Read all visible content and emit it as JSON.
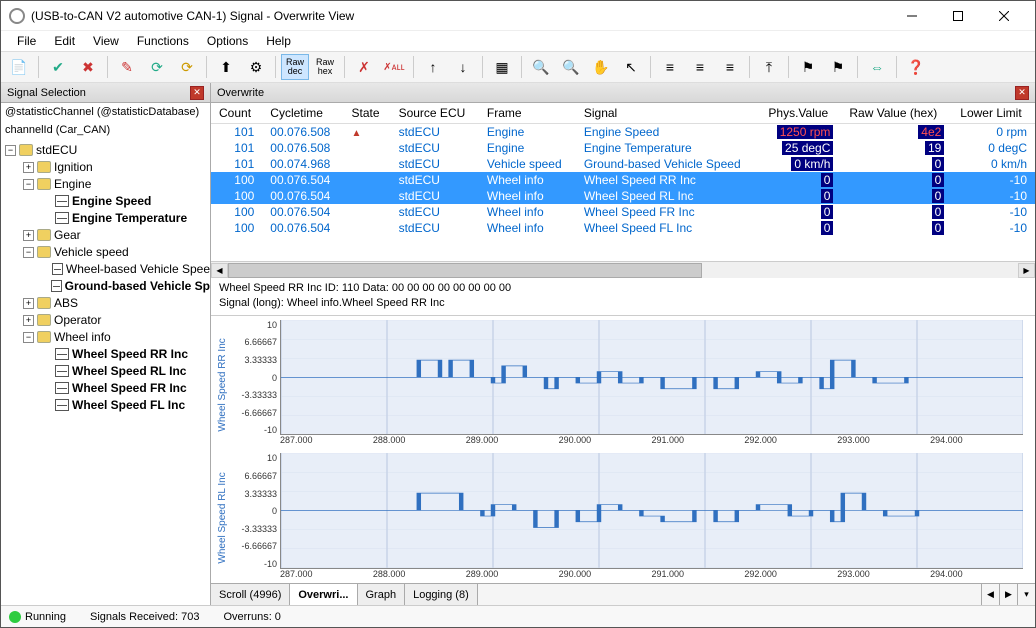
{
  "window": {
    "title": "(USB-to-CAN V2 automotive  CAN-1) Signal - Overwrite View"
  },
  "menu": [
    "File",
    "Edit",
    "View",
    "Functions",
    "Options",
    "Help"
  ],
  "sidebar": {
    "title": "Signal Selection",
    "info1": "@statisticChannel  (@statisticDatabase)",
    "info2": "channelId  (Car_CAN)",
    "tree": [
      {
        "lvl": 0,
        "exp": "-",
        "icon": "db",
        "label": "stdECU",
        "bold": false
      },
      {
        "lvl": 1,
        "exp": "+",
        "icon": "db",
        "label": "Ignition",
        "bold": false
      },
      {
        "lvl": 1,
        "exp": "-",
        "icon": "db",
        "label": "Engine",
        "bold": false
      },
      {
        "lvl": 2,
        "exp": "",
        "icon": "sig",
        "label": "Engine Speed",
        "bold": true
      },
      {
        "lvl": 2,
        "exp": "",
        "icon": "sig",
        "label": "Engine Temperature",
        "bold": true
      },
      {
        "lvl": 1,
        "exp": "+",
        "icon": "db",
        "label": "Gear",
        "bold": false
      },
      {
        "lvl": 1,
        "exp": "-",
        "icon": "db",
        "label": "Vehicle speed",
        "bold": false
      },
      {
        "lvl": 2,
        "exp": "",
        "icon": "sig",
        "label": "Wheel-based Vehicle Spee",
        "bold": false
      },
      {
        "lvl": 2,
        "exp": "",
        "icon": "sig",
        "label": "Ground-based Vehicle Sp",
        "bold": true
      },
      {
        "lvl": 1,
        "exp": "+",
        "icon": "db",
        "label": "ABS",
        "bold": false
      },
      {
        "lvl": 1,
        "exp": "+",
        "icon": "db",
        "label": "Operator",
        "bold": false
      },
      {
        "lvl": 1,
        "exp": "-",
        "icon": "db",
        "label": "Wheel info",
        "bold": false
      },
      {
        "lvl": 2,
        "exp": "",
        "icon": "sig",
        "label": "Wheel Speed RR Inc",
        "bold": true
      },
      {
        "lvl": 2,
        "exp": "",
        "icon": "sig",
        "label": "Wheel Speed RL Inc",
        "bold": true
      },
      {
        "lvl": 2,
        "exp": "",
        "icon": "sig",
        "label": "Wheel Speed FR Inc",
        "bold": true
      },
      {
        "lvl": 2,
        "exp": "",
        "icon": "sig",
        "label": "Wheel Speed FL Inc",
        "bold": true
      }
    ]
  },
  "overwrite": {
    "title": "Overwrite",
    "columns": [
      "Count",
      "Cycletime",
      "State",
      "Source ECU",
      "Frame",
      "Signal",
      "Phys.Value",
      "Raw Value (hex)",
      "Lower Limit"
    ],
    "rows": [
      {
        "count": "101",
        "cycle": "00.076.508",
        "state": "▲",
        "ecu": "stdECU",
        "frame": "Engine",
        "signal": "Engine Speed",
        "pv": "1250 rpm",
        "pvcls": "red",
        "rv": "4e2",
        "rvcls": "red",
        "ll": "0 rpm",
        "sel": false
      },
      {
        "count": "101",
        "cycle": "00.076.508",
        "state": "",
        "ecu": "stdECU",
        "frame": "Engine",
        "signal": "Engine Temperature",
        "pv": "25 degC",
        "pvcls": "dark",
        "rv": "19",
        "rvcls": "dark",
        "ll": "0 degC",
        "sel": false
      },
      {
        "count": "101",
        "cycle": "00.074.968",
        "state": "",
        "ecu": "stdECU",
        "frame": "Vehicle speed",
        "signal": "Ground-based Vehicle Speed",
        "pv": "0 km/h",
        "pvcls": "dark",
        "rv": "0",
        "rvcls": "dark",
        "ll": "0 km/h",
        "sel": false
      },
      {
        "count": "100",
        "cycle": "00.076.504",
        "state": "",
        "ecu": "stdECU",
        "frame": "Wheel info",
        "signal": "Wheel Speed RR Inc",
        "pv": "0",
        "pvcls": "dark",
        "rv": "0",
        "rvcls": "dark",
        "ll": "-10",
        "sel": true
      },
      {
        "count": "100",
        "cycle": "00.076.504",
        "state": "",
        "ecu": "stdECU",
        "frame": "Wheel info",
        "signal": "Wheel Speed RL Inc",
        "pv": "0",
        "pvcls": "dark",
        "rv": "0",
        "rvcls": "dark",
        "ll": "-10",
        "sel": true
      },
      {
        "count": "100",
        "cycle": "00.076.504",
        "state": "",
        "ecu": "stdECU",
        "frame": "Wheel info",
        "signal": "Wheel Speed FR Inc",
        "pv": "0",
        "pvcls": "dark",
        "rv": "0",
        "rvcls": "dark",
        "ll": "-10",
        "sel": false
      },
      {
        "count": "100",
        "cycle": "00.076.504",
        "state": "",
        "ecu": "stdECU",
        "frame": "Wheel info",
        "signal": "Wheel Speed FL Inc",
        "pv": "0",
        "pvcls": "dark",
        "rv": "0",
        "rvcls": "dark",
        "ll": "-10",
        "sel": false
      }
    ]
  },
  "detail": {
    "line1": "Wheel Speed RR Inc   ID: 110     Data:   00 00 00 00 00 00 00 00",
    "line2": "Signal (long): Wheel info.Wheel Speed RR Inc"
  },
  "tabs": {
    "items": [
      "Scroll (4996)",
      "Overwri...",
      "Graph",
      "Logging (8)"
    ],
    "active": 1
  },
  "status": {
    "state": "Running",
    "signals": "Signals Received: 703",
    "overruns": "Overruns: 0"
  },
  "chart_data": [
    {
      "type": "line",
      "ylabel": "Wheel Speed RR Inc",
      "yticks": [
        "10",
        "6.66667",
        "3.33333",
        "0",
        "-3.33333",
        "-6.66667",
        "-10"
      ],
      "xticks": [
        "287.000",
        "288.000",
        "289.000",
        "290.000",
        "291.000",
        "292.000",
        "293.000",
        "294.000"
      ],
      "xlim": [
        287,
        294
      ],
      "ylim": [
        -10,
        10
      ],
      "x": [
        287,
        288.0,
        288.3,
        288.5,
        288.6,
        288.8,
        289.0,
        289.1,
        289.3,
        289.5,
        289.6,
        289.8,
        290.0,
        290.2,
        290.4,
        290.6,
        290.9,
        291.1,
        291.3,
        291.5,
        291.7,
        291.9,
        292.1,
        292.2,
        292.4,
        292.6,
        292.9,
        293.1,
        294
      ],
      "y": [
        0,
        0,
        3,
        0,
        3,
        0,
        -1,
        2,
        0,
        -2,
        0,
        -1,
        1,
        -1,
        0,
        -2,
        0,
        -2,
        0,
        1,
        -1,
        0,
        -2,
        3,
        0,
        -1,
        0,
        0,
        0
      ]
    },
    {
      "type": "line",
      "ylabel": "Wheel Speed RL Inc",
      "yticks": [
        "10",
        "6.66667",
        "3.33333",
        "0",
        "-3.33333",
        "-6.66667",
        "-10"
      ],
      "xticks": [
        "287.000",
        "288.000",
        "289.000",
        "290.000",
        "291.000",
        "292.000",
        "293.000",
        "294.000"
      ],
      "xlim": [
        287,
        294
      ],
      "ylim": [
        -10,
        10
      ],
      "x": [
        287,
        288.0,
        288.3,
        288.5,
        288.7,
        288.9,
        289.0,
        289.2,
        289.4,
        289.6,
        289.8,
        290.0,
        290.2,
        290.4,
        290.6,
        290.9,
        291.1,
        291.3,
        291.5,
        291.8,
        292.0,
        292.2,
        292.3,
        292.5,
        292.7,
        293.0,
        293.2,
        294
      ],
      "y": [
        0,
        0,
        3,
        3,
        0,
        -1,
        1,
        0,
        -3,
        0,
        -2,
        1,
        0,
        -1,
        -2,
        0,
        -2,
        0,
        1,
        -1,
        0,
        -2,
        3,
        0,
        -1,
        0,
        0,
        0
      ]
    }
  ]
}
